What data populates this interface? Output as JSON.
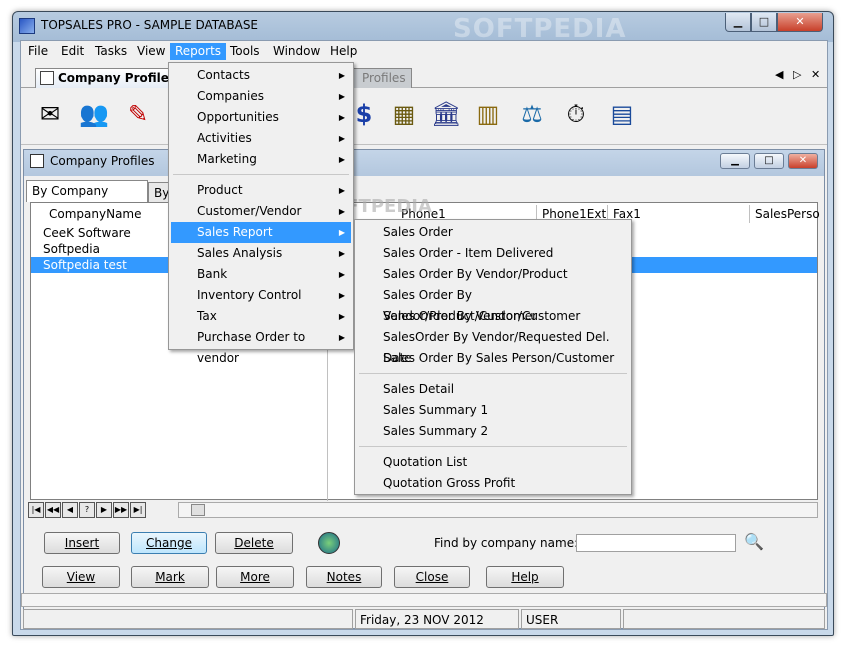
{
  "window": {
    "title": "TOPSALES PRO - SAMPLE DATABASE",
    "watermark": "SOFTPEDIA"
  },
  "menubar": [
    "File",
    "Edit",
    "Tasks",
    "View",
    "Reports",
    "Tools",
    "Window",
    "Help"
  ],
  "doc_tabs": [
    "Company Profiles",
    "Profiles"
  ],
  "child": {
    "title": "Company Profiles",
    "subtabs": [
      "By Company Name",
      "By"
    ]
  },
  "grid": {
    "columns": [
      "CompanyName",
      "Phone1",
      "Phone1Ext",
      "Fax1",
      "SalesPerso"
    ],
    "rows": [
      "CeeK Software",
      "Softpedia",
      "Softpedia test"
    ],
    "selected_row": 2
  },
  "buttons_row1": {
    "insert": "Insert",
    "change": "Change",
    "delete": "Delete"
  },
  "find": {
    "label": "Find by company name:",
    "value": ""
  },
  "buttons_row2": {
    "view": "View",
    "mark": "Mark",
    "more": "More",
    "notes": "Notes",
    "close": "Close",
    "help": "Help"
  },
  "status": {
    "date": "Friday, 23 NOV 2012",
    "user": "USER"
  },
  "reports_menu": {
    "group1": [
      "Contacts",
      "Companies",
      "Opportunities",
      "Activities",
      "Marketing"
    ],
    "group2": [
      "Product",
      "Customer/Vendor",
      "Sales Report",
      "Sales Analysis",
      "Bank",
      "Inventory Control",
      "Tax",
      "Purchase Order to vendor"
    ],
    "highlighted": "Sales Report"
  },
  "sales_report_menu": {
    "group1": [
      "Sales Order",
      "Sales Order - Item Delivered",
      "Sales Order By Vendor/Product",
      "Sales Order By Vendor/Product/Customer",
      "Sales Order By Vendor/Customer",
      "SalesOrder By Vendor/Requested Del. Date",
      "Sales Order By Sales Person/Customer"
    ],
    "group2": [
      "Sales Detail",
      "Sales Summary 1",
      "Sales Summary 2"
    ],
    "group3": [
      "Quotation List",
      "Quotation Gross Profit"
    ]
  }
}
